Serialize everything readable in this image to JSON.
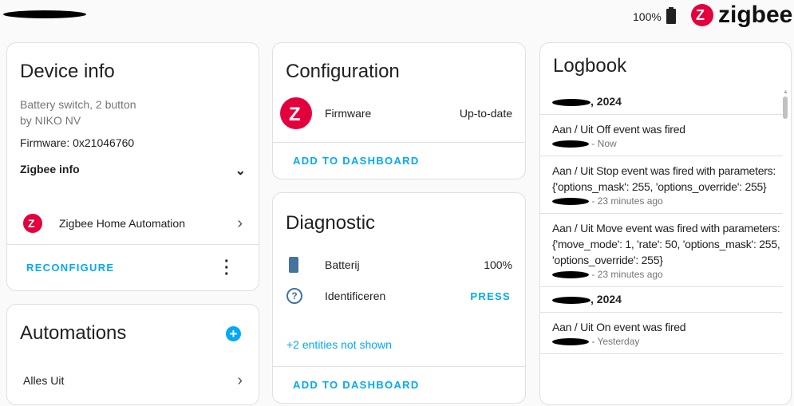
{
  "topbar": {
    "battery": "100%",
    "brand": "zigbee"
  },
  "device_info": {
    "title": "Device info",
    "model": "Battery switch, 2 button",
    "manufacturer": "by NIKO NV",
    "firmware": "Firmware: 0x21046760",
    "zigbee_info": "Zigbee info",
    "integration": "Zigbee Home Automation",
    "reconfigure": "RECONFIGURE"
  },
  "automations": {
    "title": "Automations",
    "items": [
      "Alles Uit"
    ]
  },
  "configuration": {
    "title": "Configuration",
    "entity": "Firmware",
    "state": "Up-to-date",
    "add": "ADD TO DASHBOARD"
  },
  "diagnostic": {
    "title": "Diagnostic",
    "battery_label": "Batterij",
    "battery_value": "100%",
    "identify_label": "Identificeren",
    "identify_action": "PRESS",
    "hidden": "+2 entities not shown",
    "add": "ADD TO DASHBOARD"
  },
  "logbook": {
    "title": "Logbook",
    "day_suffix": ", 2024",
    "entries": [
      {
        "msg": "Aan / Uit Off event was fired",
        "time": "- Now"
      },
      {
        "msg": "Aan / Uit Stop event was fired with parameters: {'options_mask': 255, 'options_override': 255}",
        "time": "- 23 minutes ago"
      },
      {
        "msg": "Aan / Uit Move event was fired with parameters: {'move_mode': 1, 'rate': 50, 'options_mask': 255, 'options_override': 255}",
        "time": "- 23 minutes ago"
      },
      {
        "msg": "Aan / Uit On event was fired",
        "time": "- Yesterday"
      }
    ]
  },
  "colors": {
    "accent": "#03a9f4",
    "zigbee": "#e4003c",
    "icon": "#44739e"
  }
}
